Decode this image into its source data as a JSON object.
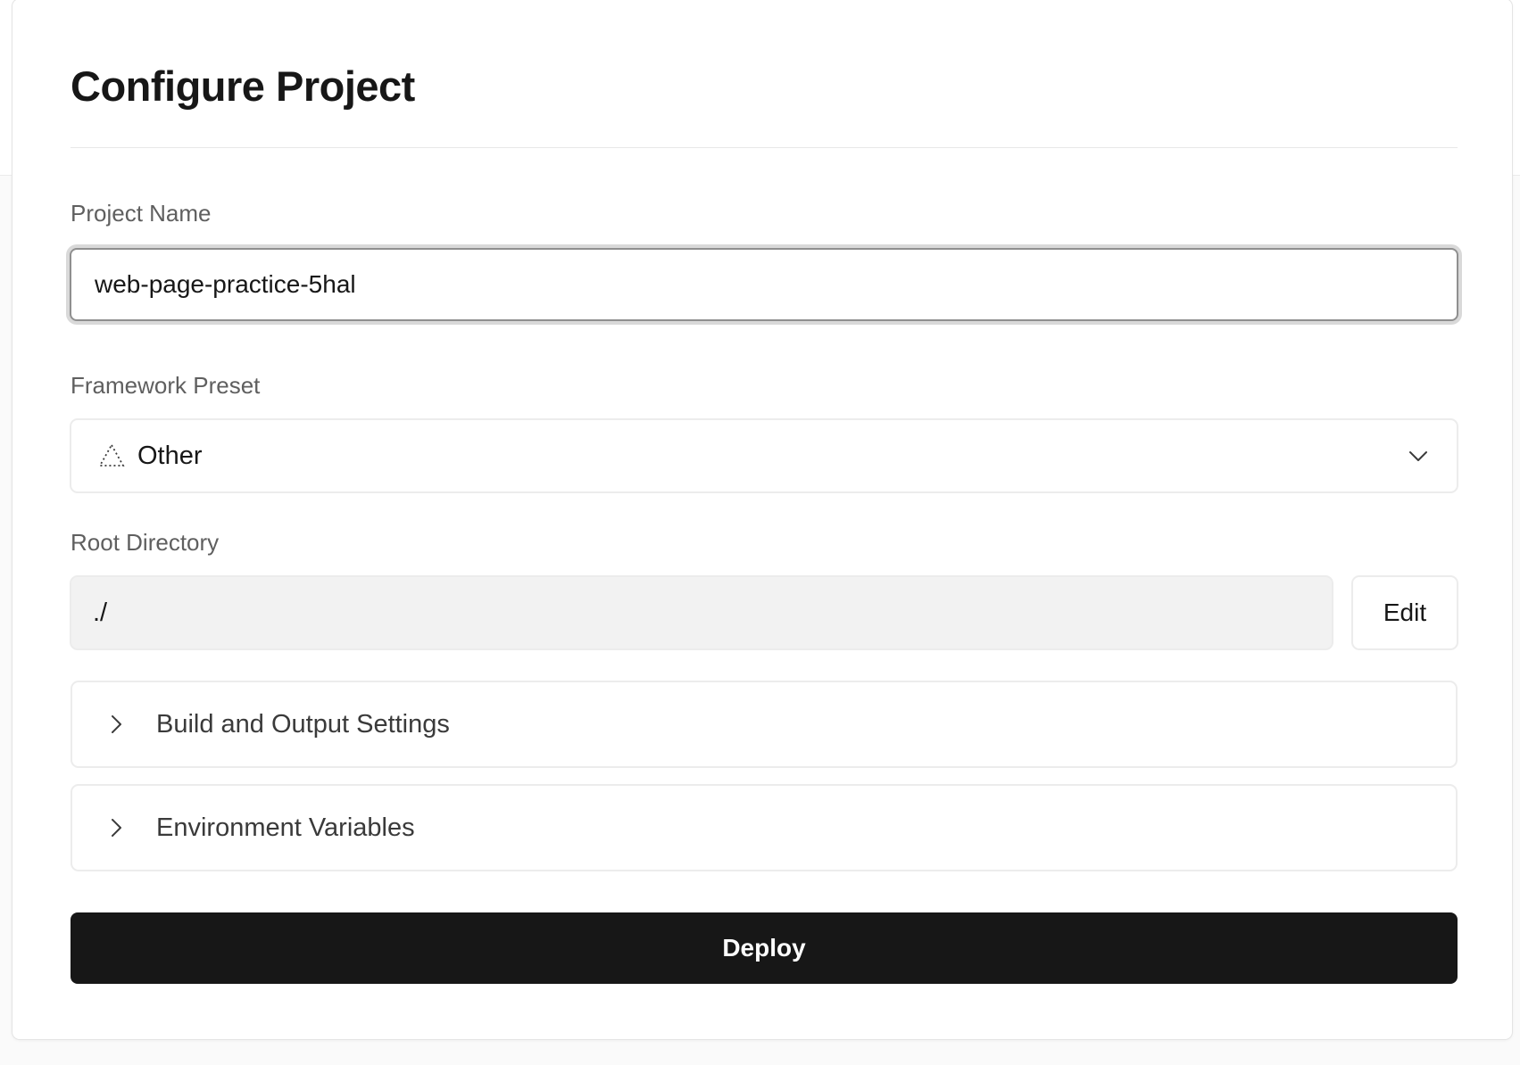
{
  "page": {
    "title": "Configure Project"
  },
  "project_name": {
    "label": "Project Name",
    "value": "web-page-practice-5hal"
  },
  "framework": {
    "label": "Framework Preset",
    "selected": "Other",
    "icon": "triangle-dotted-icon"
  },
  "root_directory": {
    "label": "Root Directory",
    "value": "./",
    "edit_label": "Edit"
  },
  "sections": [
    {
      "label": "Build and Output Settings",
      "icon": "chevron-right-icon"
    },
    {
      "label": "Environment Variables",
      "icon": "chevron-right-icon"
    }
  ],
  "deploy": {
    "label": "Deploy"
  },
  "colors": {
    "primary_button": "#171717",
    "muted_text": "#5f5f5f",
    "border": "#ececec",
    "readonly_bg": "#f2f2f2"
  }
}
